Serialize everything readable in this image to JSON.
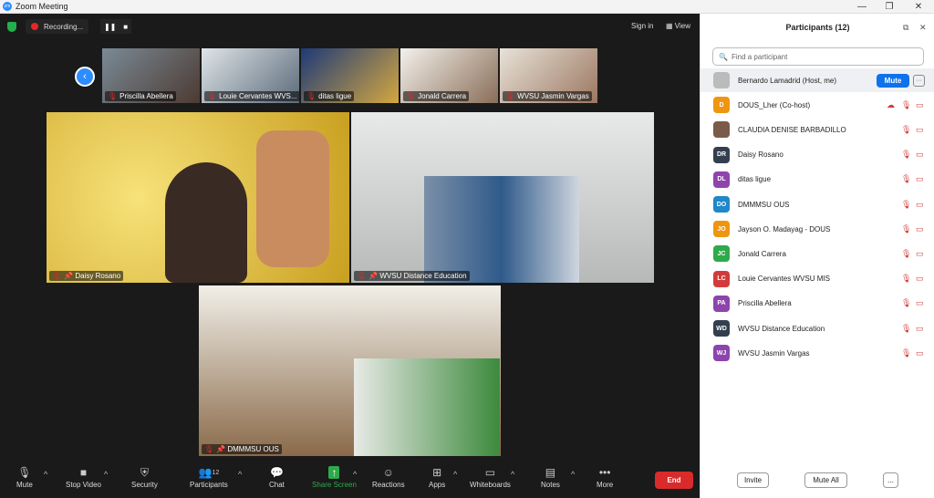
{
  "window": {
    "title": "Zoom Meeting"
  },
  "top": {
    "recording": "Recording...",
    "sign_in": "Sign in",
    "view": "View"
  },
  "gallery": [
    {
      "name": "Priscilla Abellera"
    },
    {
      "name": "Louie Cervantes WVS..."
    },
    {
      "name": "ditas ligue"
    },
    {
      "name": "Jonald Carrera"
    },
    {
      "name": "WVSU Jasmin Vargas"
    }
  ],
  "main": [
    {
      "name": "Daisy Rosano"
    },
    {
      "name": "WVSU Distance Education"
    },
    {
      "name": "DMMMSU OUS"
    }
  ],
  "toolbar": {
    "mute": "Mute",
    "stop_video": "Stop Video",
    "security": "Security",
    "participants": "Participants",
    "participants_count": "12",
    "chat": "Chat",
    "share_screen": "Share Screen",
    "reactions": "Reactions",
    "apps": "Apps",
    "whiteboards": "Whiteboards",
    "notes": "Notes",
    "more": "More",
    "end": "End"
  },
  "panel": {
    "title": "Participants (12)",
    "search_placeholder": "Find a participant",
    "mute_label": "Mute",
    "invite": "Invite",
    "mute_all": "Mute All",
    "more": "...",
    "participants": [
      {
        "name": "Bernardo Lamadrid (Host, me)",
        "initials": "",
        "color": "#bbbbbb"
      },
      {
        "name": "DOUS_Lher (Co-host)",
        "initials": "D",
        "color": "#f0950f"
      },
      {
        "name": "CLAUDIA DENISE BARBADILLO",
        "initials": "",
        "color": "#7a5a48"
      },
      {
        "name": "Daisy Rosano",
        "initials": "DR",
        "color": "#333f4e"
      },
      {
        "name": "ditas ligue",
        "initials": "DL",
        "color": "#8e44ad"
      },
      {
        "name": "DMMMSU OUS",
        "initials": "DO",
        "color": "#1e88c9"
      },
      {
        "name": "Jayson O. Madayag - DOUS",
        "initials": "JO",
        "color": "#f0950f"
      },
      {
        "name": "Jonald Carrera",
        "initials": "JC",
        "color": "#2eaa4a"
      },
      {
        "name": "Louie Cervantes WVSU MIS",
        "initials": "LC",
        "color": "#d23b3b"
      },
      {
        "name": "Priscilla Abellera",
        "initials": "PA",
        "color": "#8e44ad"
      },
      {
        "name": "WVSU Distance Education",
        "initials": "WD",
        "color": "#333f4e"
      },
      {
        "name": "WVSU Jasmin Vargas",
        "initials": "WJ",
        "color": "#8e44ad"
      }
    ]
  }
}
